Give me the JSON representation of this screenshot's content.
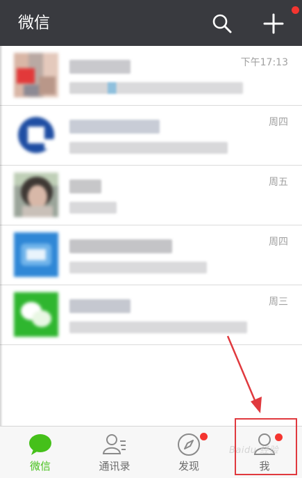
{
  "app": {
    "title": "微信",
    "search_icon": "search-icon",
    "add_icon": "plus-icon",
    "notification_dot_color": "#f43530"
  },
  "chats": [
    {
      "time": "下午17:13",
      "avatar": "blurred-photo-avatar"
    },
    {
      "time": "周四",
      "avatar": "blurred-blue-logo-avatar"
    },
    {
      "time": "周五",
      "avatar": "blurred-portrait-avatar"
    },
    {
      "time": "周四",
      "avatar": "blurred-blue-app-avatar"
    },
    {
      "time": "周三",
      "avatar": "blurred-green-wechat-avatar"
    }
  ],
  "tabs": [
    {
      "label": "微信",
      "icon": "chat-bubble-icon",
      "active": true,
      "badge": false
    },
    {
      "label": "通讯录",
      "icon": "contacts-icon",
      "active": false,
      "badge": false
    },
    {
      "label": "发现",
      "icon": "compass-icon",
      "active": false,
      "badge": true
    },
    {
      "label": "我",
      "icon": "person-icon",
      "active": false,
      "badge": true
    }
  ],
  "colors": {
    "header_bg": "#393a3f",
    "accent_green": "#45c01a",
    "annotation_red": "#e0393e"
  },
  "watermark": "Baidu 经验"
}
